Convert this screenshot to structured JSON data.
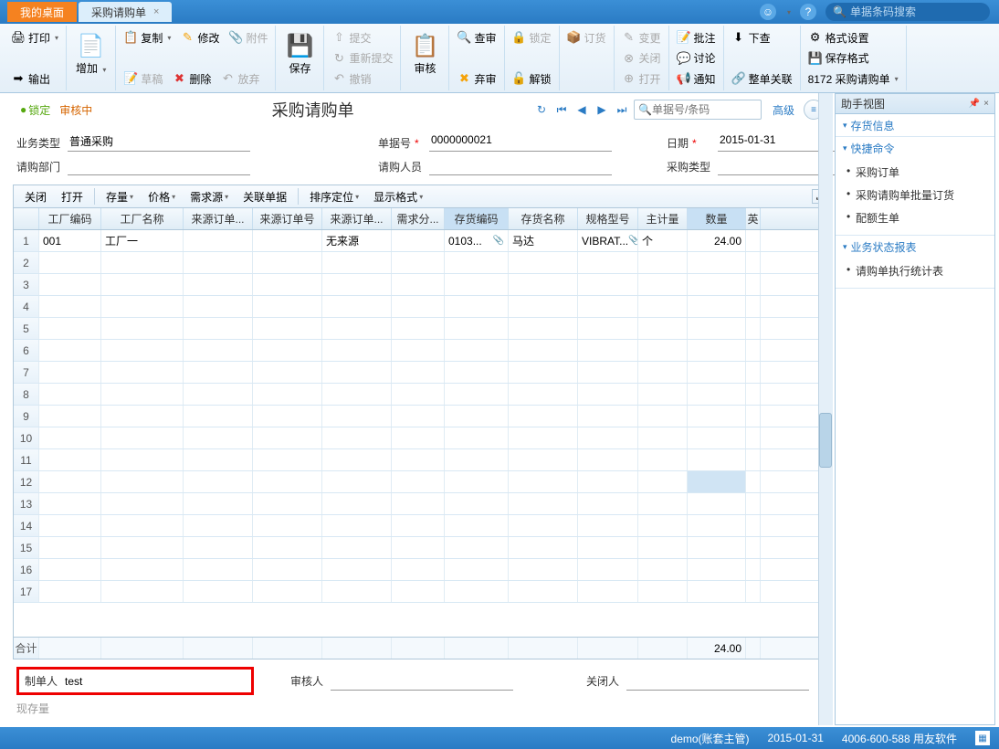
{
  "tabs": {
    "desktop": "我的桌面",
    "active": "采购请购单"
  },
  "topSearch": {
    "placeholder": "单据条码搜索"
  },
  "ribbon": {
    "print": "打印",
    "export": "输出",
    "add": "增加",
    "copy": "复制",
    "modify": "修改",
    "attach": "附件",
    "draft": "草稿",
    "delete": "删除",
    "discard": "放弃",
    "save": "保存",
    "submit": "提交",
    "resubmit": "重新提交",
    "undo": "撤销",
    "audit": "审核",
    "auditCheck": "查审",
    "reject": "弃审",
    "lock": "锁定",
    "unlock": "解锁",
    "order": "订货",
    "change": "变更",
    "close": "关闭",
    "open": "打开",
    "annotate": "批注",
    "discuss": "讨论",
    "notify": "通知",
    "drilldown": "下查",
    "linkAll": "整单关联",
    "formatSet": "格式设置",
    "saveFormat": "保存格式",
    "formatName": "8172 采购请购单"
  },
  "docHeader": {
    "lock": "锁定",
    "auditStatus": "审核中",
    "title": "采购请购单",
    "searchPlaceholder": "单据号/条码",
    "advanced": "高级"
  },
  "form": {
    "bizTypeLabel": "业务类型",
    "bizTypeValue": "普通采购",
    "docNoLabel": "单据号",
    "docNoValue": "0000000021",
    "dateLabel": "日期",
    "dateValue": "2015-01-31",
    "deptLabel": "请购部门",
    "deptValue": "",
    "personLabel": "请购人员",
    "personValue": "",
    "purTypeLabel": "采购类型",
    "purTypeValue": ""
  },
  "gridToolbar": {
    "close": "关闭",
    "open": "打开",
    "stock": "存量",
    "price": "价格",
    "source": "需求源",
    "linkDoc": "关联单据",
    "sort": "排序定位",
    "display": "显示格式"
  },
  "gridColumns": [
    "",
    "工厂编码",
    "工厂名称",
    "来源订单...",
    "来源订单号",
    "来源订单...",
    "需求分...",
    "存货编码",
    "存货名称",
    "规格型号",
    "主计量",
    "数量",
    "英"
  ],
  "gridHighlight": [
    7,
    11
  ],
  "gridRows": [
    {
      "num": "1",
      "factoryCode": "001",
      "factoryName": "工厂一",
      "srcType": "",
      "srcNo": "",
      "srcLine": "无来源",
      "demand": "",
      "invCode": "0103...",
      "invName": "马达",
      "spec": "VIBRAT...",
      "uom": "个",
      "qty": "24.00"
    }
  ],
  "emptyRows": 16,
  "gridFooter": {
    "label": "合计",
    "qty": "24.00"
  },
  "footerFields": {
    "makerLabel": "制单人",
    "makerValue": "test",
    "auditorLabel": "审核人",
    "auditorValue": "",
    "closerLabel": "关闭人",
    "closerValue": "",
    "stockLabel": "现存量"
  },
  "sidebar": {
    "title": "助手视图",
    "sections": [
      {
        "header": "存货信息",
        "items": []
      },
      {
        "header": "快捷命令",
        "items": [
          "采购订单",
          "采购请购单批量订货",
          "配额生单"
        ]
      },
      {
        "header": "业务状态报表",
        "items": [
          "请购单执行统计表"
        ]
      }
    ]
  },
  "statusBar": {
    "user": "demo(账套主管)",
    "date": "2015-01-31",
    "phone": "4006-600-588 用友软件"
  }
}
